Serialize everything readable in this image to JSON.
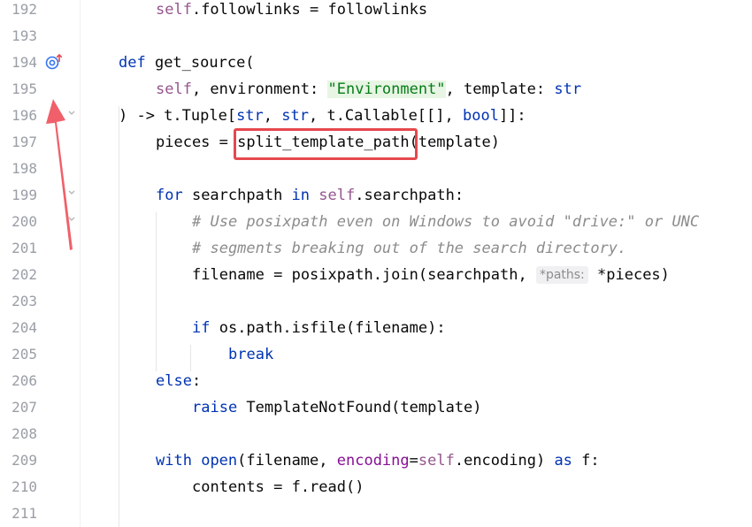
{
  "editor": {
    "line_numbers": [
      "192",
      "193",
      "194",
      "195",
      "196",
      "197",
      "198",
      "199",
      "200",
      "201",
      "202",
      "203",
      "204",
      "205",
      "206",
      "207",
      "208",
      "209",
      "210",
      "211"
    ],
    "lines": {
      "l192": {
        "self": "self",
        "rest": ".followlinks = followlinks"
      },
      "l194": {
        "kw": "def",
        "name": " get_source("
      },
      "l195": {
        "self": "self",
        "a": ", environment: ",
        "str": "\"Environment\"",
        "b": ", template: ",
        "type": "str"
      },
      "l196": {
        "a": ") -> t.Tuple[",
        "t1": "str",
        "b": ", ",
        "t2": "str",
        "c": ", t.Callable[[], ",
        "t3": "bool",
        "d": "]]:"
      },
      "l197": {
        "a": "pieces = ",
        "fn": "split_template_path",
        "b": "(template)"
      },
      "l199": {
        "kw1": "for",
        "a": " searchpath ",
        "kw2": "in",
        "sp": " ",
        "self": "self",
        "b": ".searchpath:"
      },
      "l200": {
        "comment": "# Use posixpath even on Windows to avoid \"drive:\" or UNC"
      },
      "l201": {
        "comment": "# segments breaking out of the search directory."
      },
      "l202": {
        "a": "filename = posixpath.join(searchpath, ",
        "hint": "*paths:",
        "b": " *pieces)"
      },
      "l204": {
        "kw": "if",
        "a": " os.path.isfile(filename):"
      },
      "l205": {
        "kw": "break"
      },
      "l206": {
        "kw": "else",
        "a": ":"
      },
      "l207": {
        "kw": "raise",
        "a": " TemplateNotFound(template)"
      },
      "l209": {
        "kw1": "with",
        "a": " ",
        "fn": "open",
        "b": "(filename, ",
        "param": "encoding",
        "eq": "=",
        "self": "self",
        "c": ".encoding) ",
        "kw2": "as",
        "d": " f:"
      },
      "l210": {
        "a": "contents = f.read()"
      }
    }
  },
  "gutter": {
    "override_icon": "override-method-icon",
    "fold_icon": "fold-chevron-icon"
  },
  "annotation": {
    "arrow_color": "#f0606a",
    "box_color": "#e5484d"
  }
}
